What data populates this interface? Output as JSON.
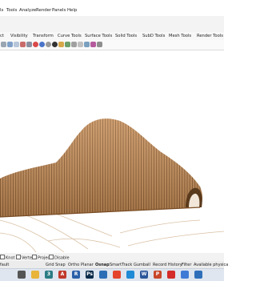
{
  "menu": [
    "ls",
    "Tools",
    "Analyze",
    "Render",
    "Panels",
    "Help"
  ],
  "tabs": [
    "ct",
    "Visibility",
    "Transform",
    "Curve Tools",
    "Surface Tools",
    "Solid Tools",
    "SubD Tools",
    "Mesh Tools",
    "Render Tools"
  ],
  "osnap": [
    "Knot",
    "Vertex",
    "Project",
    "Disable"
  ],
  "status": [
    "fault",
    "Grid Snap",
    "Ortho",
    "Planar",
    "Osnap",
    "SmartTrack",
    "Gumball",
    "Record History",
    "Filter",
    "Available physica"
  ],
  "taskbar": [
    {
      "icon": "rhino-icon",
      "glyph": "",
      "color": "#555555"
    },
    {
      "icon": "explorer-icon",
      "glyph": "",
      "color": "#e8b53a"
    },
    {
      "icon": "rhino-app-icon",
      "glyph": "3",
      "color": "#2b7c84"
    },
    {
      "icon": "autocad-icon",
      "glyph": "A",
      "color": "#c0392b"
    },
    {
      "icon": "revit-icon",
      "glyph": "R",
      "color": "#2a5fa8"
    },
    {
      "icon": "photoshop-icon",
      "glyph": "Ps",
      "color": "#0b2b4a"
    },
    {
      "icon": "lumion-icon",
      "glyph": "",
      "color": "#2c6eb5"
    },
    {
      "icon": "chrome-icon",
      "glyph": "",
      "color": "#e4442c"
    },
    {
      "icon": "edge-icon",
      "glyph": "",
      "color": "#1f8ad6"
    },
    {
      "icon": "word-icon",
      "glyph": "W",
      "color": "#2b579a"
    },
    {
      "icon": "powerpoint-icon",
      "glyph": "P",
      "color": "#c8472a"
    },
    {
      "icon": "pdf-icon",
      "glyph": "",
      "color": "#d42b2b"
    },
    {
      "icon": "app-icon",
      "glyph": "",
      "color": "#3f7bd6"
    },
    {
      "icon": "store-icon",
      "glyph": "",
      "color": "#2f6fba"
    }
  ],
  "colors": {
    "model_fill": "#c8905a",
    "model_dark": "#8a5a2e",
    "curve": "#d9c1a4"
  }
}
